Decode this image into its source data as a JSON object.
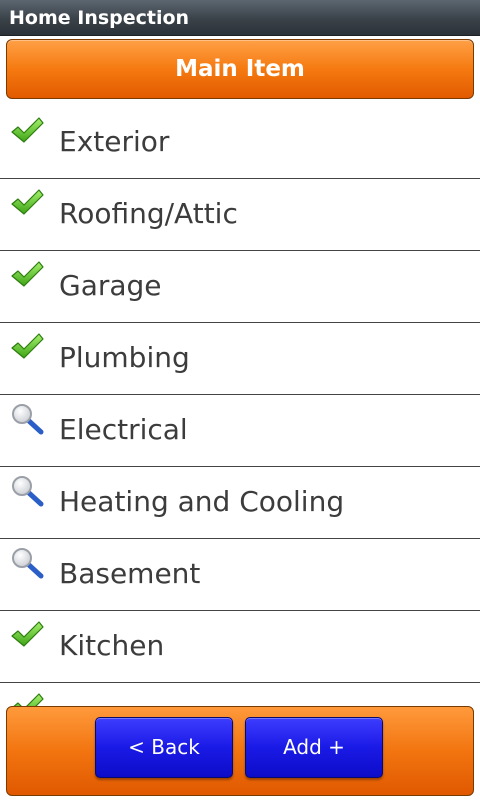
{
  "window": {
    "title": "Home Inspection"
  },
  "header": {
    "label": "Main Item"
  },
  "items": [
    {
      "label": "Exterior",
      "status": "check-icon"
    },
    {
      "label": "Roofing/Attic",
      "status": "check-icon"
    },
    {
      "label": "Garage",
      "status": "check-icon"
    },
    {
      "label": "Plumbing",
      "status": "check-icon"
    },
    {
      "label": "Electrical",
      "status": "magnifier-icon"
    },
    {
      "label": "Heating and Cooling",
      "status": "magnifier-icon"
    },
    {
      "label": "Basement",
      "status": "magnifier-icon"
    },
    {
      "label": "Kitchen",
      "status": "check-icon"
    },
    {
      "label": "",
      "status": "check-icon"
    }
  ],
  "footer": {
    "back_label": "< Back",
    "add_label": "Add +"
  },
  "colors": {
    "accent_orange": "#f57a10",
    "button_blue": "#1a1ae6",
    "check_green": "#5fc52a",
    "title_bar": "#3a4249"
  }
}
